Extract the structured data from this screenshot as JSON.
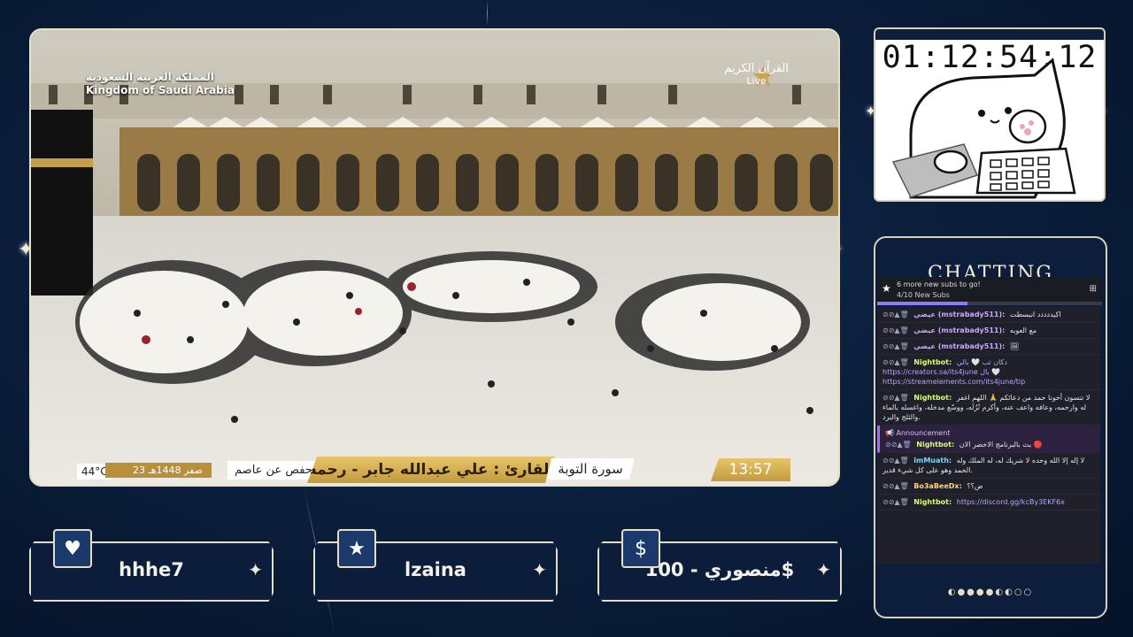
{
  "video": {
    "watermark_right_line1": "القرآن الكريم",
    "watermark_right_line2": "Live",
    "watermark_left_line1": "المملكة العربية السعودية",
    "watermark_left_line2": "Kingdom of Saudi Arabia",
    "temperature": "44°C",
    "hijri_date": "23 صفر 1448هـ",
    "riwaya": "رواية حفص عن عاصم",
    "qari": "القارئ : علي عبدالله جابر - رحمه الله",
    "surah": "سورة التوبة",
    "clock": "13:57"
  },
  "timer": {
    "value": "01:12:54:12"
  },
  "chat": {
    "title": "CHATTING",
    "goal_title": "6 more new subs to go!",
    "goal_progress": "4/10 New Subs",
    "goal_fraction": 0.4,
    "messages": [
      {
        "badges": "⊘⊘▲🗑",
        "user": "عيضي (mstrabady511):",
        "text": "اكيددددد انبسطت",
        "color": "#c9a8ff"
      },
      {
        "badges": "⊘⊘▲🗑",
        "user": "عيضي (mstrabady511):",
        "text": "مع العوبه",
        "color": "#c9a8ff"
      },
      {
        "badges": "⊘⊘▲🗑",
        "user": "عيضي (mstrabady511):",
        "text": "🖼",
        "color": "#c9a8ff"
      },
      {
        "badges": "⊘⊘▲🗑",
        "user": "Nightbot:",
        "text": "دكان ثب 🤍 بالي https://creators.sa/its4june بال 🤍 https://streamelements.com/its4june/tip",
        "color": "#d6ff6b"
      },
      {
        "badges": "⊘⊘▲🗑",
        "user": "Nightbot:",
        "text": "لا تنسون أخونا حمد من دعائكم 🙏 اللهم اغفر له وارحمه، وعافه واعف عنه، وأكرم نُزُلَه، ووسّع مدخله، واغسله بالماء والثلج والبرد.",
        "color": "#d6ff6b"
      }
    ],
    "announcement_label": "Announcement",
    "announcement": {
      "badges": "⊘⊘▲🗑",
      "user": "Nightbot:",
      "text": "بث بالبرنامج الاخضر الان 🔴",
      "color": "#d6ff6b"
    },
    "messages_after": [
      {
        "badges": "⊘⊘▲🗑",
        "user": "imMuath:",
        "text": "لا إله إلا الله وحده لا شريك له، له الملك وله الحمد وهو على كل شيء قدير.",
        "color": "#79d7ff"
      },
      {
        "badges": "⊘⊘▲🗑",
        "user": "Bo3aBeeDx:",
        "text": "ض؟؟",
        "color": "#ffd86b"
      },
      {
        "badges": "⊘⊘▲🗑",
        "user": "Nightbot:",
        "text": "https://discord.gg/kcBy3EKF6x",
        "color": "#d6ff6b"
      }
    ],
    "moon_phases": "◐●●●●◐◐○○"
  },
  "cards": [
    {
      "name": "hhhe7",
      "icon": "heart-icon",
      "glyph": "♥"
    },
    {
      "name": "lzaina",
      "icon": "star-icon",
      "glyph": "★"
    },
    {
      "name": "منصوري - 100$",
      "icon": "dollar-icon",
      "glyph": "$"
    }
  ],
  "colors": {
    "accent_gold": "#c39a3e",
    "frame": "#e9e2c9",
    "background": "#0b1f3d"
  }
}
